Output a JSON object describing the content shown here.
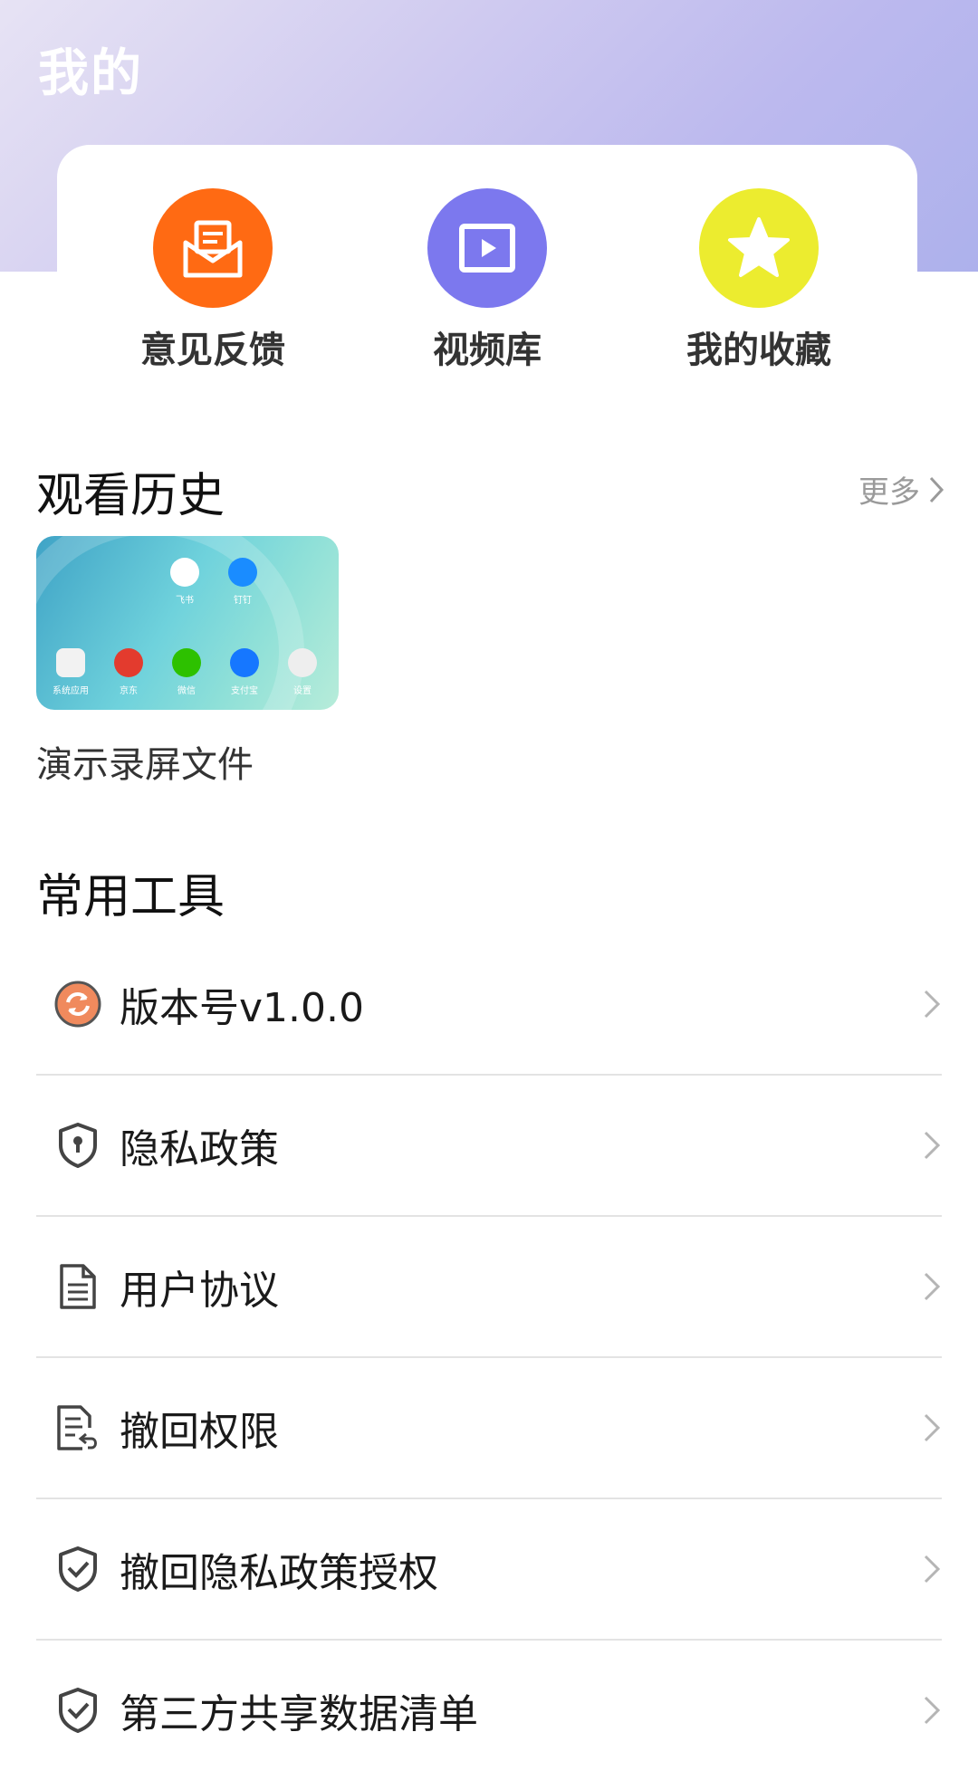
{
  "header": {
    "title": "我的"
  },
  "quick_actions": [
    {
      "label": "意见反馈",
      "icon": "mail-icon",
      "color": "#ff6a13"
    },
    {
      "label": "视频库",
      "icon": "play-icon",
      "color": "#7c78ee"
    },
    {
      "label": "我的收藏",
      "icon": "star-icon",
      "color": "#ecec2f"
    }
  ],
  "history": {
    "title": "观看历史",
    "more_label": "更多",
    "item": {
      "caption": "演示录屏文件",
      "thumb_labels": [
        "飞书",
        "钉钉",
        "系统应用",
        "京东",
        "微信",
        "支付宝",
        "设置"
      ]
    }
  },
  "tools": {
    "title": "常用工具",
    "items": [
      {
        "label": "版本号v1.0.0",
        "icon": "update-icon"
      },
      {
        "label": "隐私政策",
        "icon": "shield-lock-icon"
      },
      {
        "label": "用户协议",
        "icon": "document-icon"
      },
      {
        "label": "撤回权限",
        "icon": "document-revoke-icon"
      },
      {
        "label": "撤回隐私政策授权",
        "icon": "shield-check-icon"
      },
      {
        "label": "第三方共享数据清单",
        "icon": "shield-check-icon"
      }
    ]
  }
}
